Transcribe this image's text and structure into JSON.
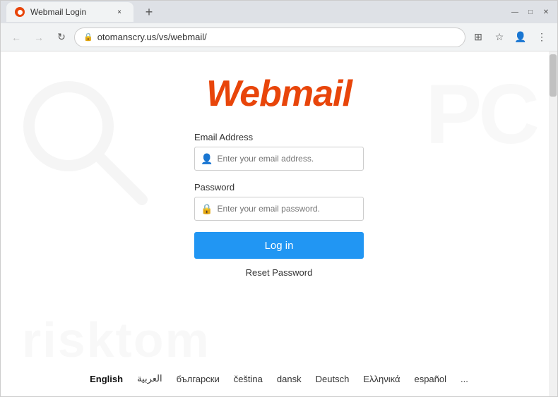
{
  "browser": {
    "tab_title": "Webmail Login",
    "url": "otomanscry.us/vs/webmail/",
    "new_tab_symbol": "+",
    "tab_close_symbol": "×"
  },
  "nav": {
    "back_symbol": "←",
    "forward_symbol": "→",
    "reload_symbol": "↻",
    "grid_symbol": "⊞",
    "star_symbol": "☆",
    "profile_symbol": "👤",
    "menu_symbol": "⋮"
  },
  "page": {
    "logo_text": "Webmail",
    "email_label": "Email Address",
    "email_placeholder": "Enter your email address.",
    "password_label": "Password",
    "password_placeholder": "Enter your email password.",
    "login_button": "Log in",
    "reset_link": "Reset Password"
  },
  "languages": [
    {
      "code": "en",
      "label": "English",
      "active": true
    },
    {
      "code": "ar",
      "label": "العربية",
      "active": false
    },
    {
      "code": "bg",
      "label": "български",
      "active": false
    },
    {
      "code": "cs",
      "label": "čeština",
      "active": false
    },
    {
      "code": "da",
      "label": "dansk",
      "active": false
    },
    {
      "code": "de",
      "label": "Deutsch",
      "active": false
    },
    {
      "code": "el",
      "label": "Ελληνικά",
      "active": false
    },
    {
      "code": "es",
      "label": "español",
      "active": false
    },
    {
      "code": "more",
      "label": "...",
      "active": false
    }
  ]
}
